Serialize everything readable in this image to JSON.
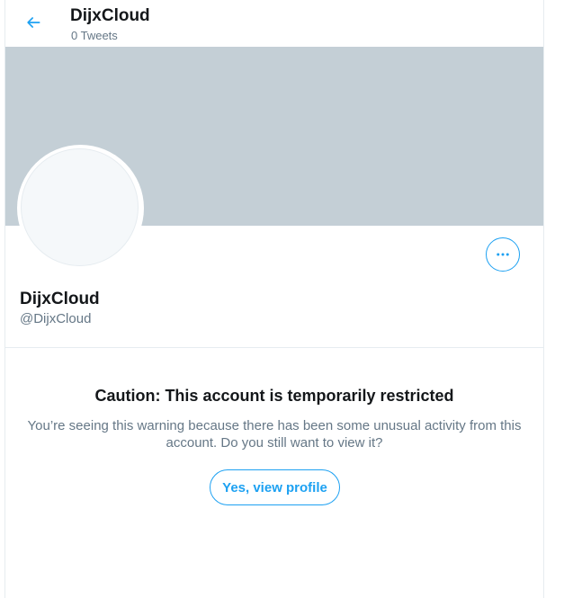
{
  "header": {
    "title": "DijxCloud",
    "subtitle": "0 Tweets",
    "back_icon": "arrow-left-icon"
  },
  "profile": {
    "display_name": "DijxCloud",
    "handle": "@DijxCloud",
    "more_icon": "more-horizontal-icon"
  },
  "warning": {
    "title": "Caution: This account is temporarily restricted",
    "body": "You’re seeing this warning because there has been some unusual activity from this account. Do you still want to view it?",
    "button_label": "Yes, view profile"
  },
  "colors": {
    "accent": "#1da1f2",
    "banner": "#c4cfd6",
    "secondary_text": "#657786",
    "primary_text": "#14171a",
    "border": "#e6ecf0"
  }
}
